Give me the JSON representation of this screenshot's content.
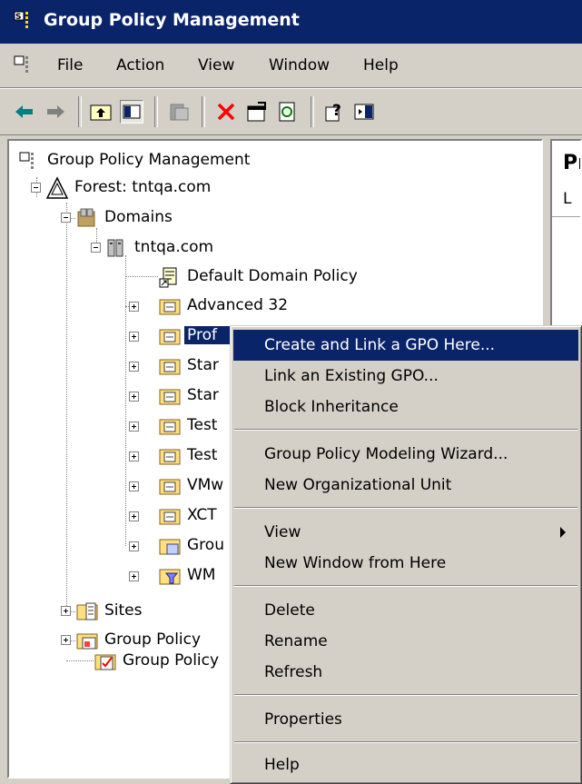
{
  "window": {
    "title": "Group Policy Management"
  },
  "menubar": {
    "items": [
      "File",
      "Action",
      "View",
      "Window",
      "Help"
    ]
  },
  "toolbar": {
    "buttons": [
      "back-arrow-icon",
      "forward-arrow-icon",
      "up-folder-icon",
      "show-hide-tree-icon",
      "export-list-icon",
      "delete-icon",
      "properties-icon",
      "refresh-icon",
      "help-icon",
      "action-pane-icon"
    ],
    "delete_color": "#ff0000",
    "back_color": "#008080"
  },
  "tree": {
    "root": "Group Policy Management",
    "forest": "Forest: tntqa.com",
    "domains": "Domains",
    "domain": "tntqa.com",
    "default_policy": "Default Domain Policy",
    "ous": [
      "Advanced 32",
      "Prof",
      "Star",
      "Star",
      "Test",
      "Test",
      "VMw",
      "XCT",
      "Grou",
      "WM"
    ],
    "sites": "Sites",
    "gp_modeling": "Group Policy",
    "gp_results": "Group Policy"
  },
  "right_pane": {
    "title": "Pr",
    "tab": "L"
  },
  "context_menu": {
    "items": [
      {
        "label": "Create and Link a GPO Here...",
        "highlighted": true
      },
      {
        "label": "Link an Existing GPO..."
      },
      {
        "label": "Block Inheritance"
      },
      {
        "label": "Group Policy Modeling Wizard..."
      },
      {
        "label": "New Organizational Unit"
      },
      {
        "label": "View",
        "submenu": true
      },
      {
        "label": "New Window from Here"
      },
      {
        "label": "Delete"
      },
      {
        "label": "Rename"
      },
      {
        "label": "Refresh"
      },
      {
        "label": "Properties"
      },
      {
        "label": "Help"
      }
    ],
    "highlight_color": "#0a246a"
  }
}
